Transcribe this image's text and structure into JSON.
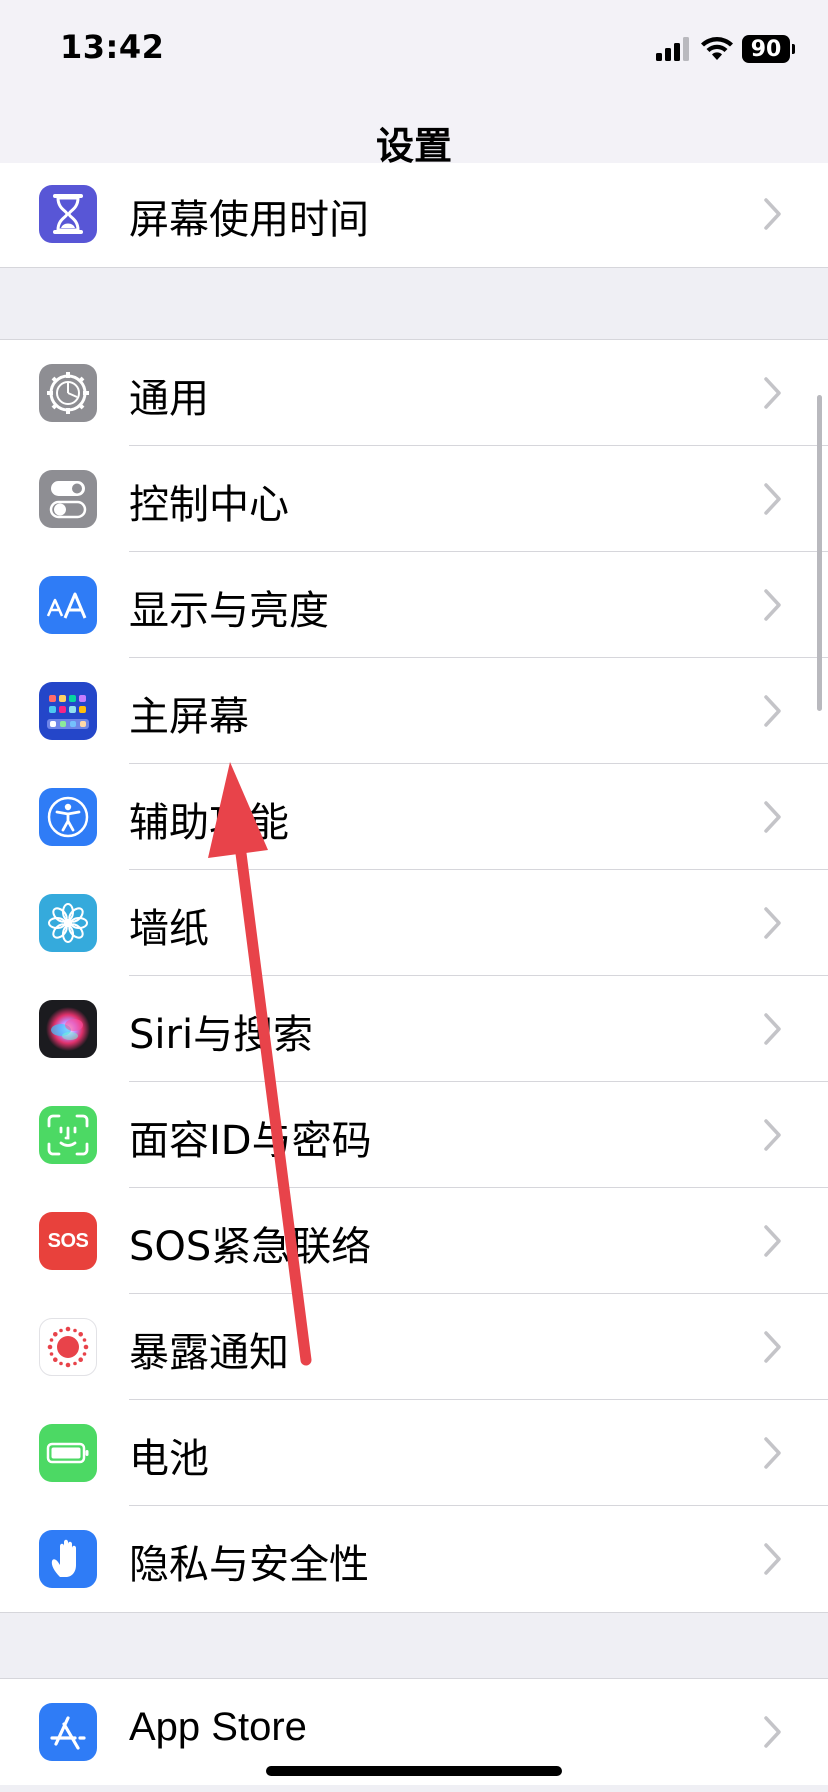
{
  "status": {
    "time": "13:42",
    "battery": "90",
    "signal_icon": "cellular-signal-icon",
    "wifi_icon": "wifi-icon"
  },
  "nav": {
    "title": "设置"
  },
  "groups": [
    [
      {
        "label": "屏幕使用时间",
        "icon": "hourglass-icon",
        "color": "#5856d6"
      }
    ],
    [
      {
        "label": "通用",
        "icon": "gear-icon",
        "color": "#8e8e93"
      },
      {
        "label": "控制中心",
        "icon": "toggle-icon",
        "color": "#8e8e93"
      },
      {
        "label": "显示与亮度",
        "icon": "text-size-icon",
        "color": "#2f7cf6"
      },
      {
        "label": "主屏幕",
        "icon": "home-screen-icon",
        "color": "#2446c9"
      },
      {
        "label": "辅助功能",
        "icon": "accessibility-icon",
        "color": "#2f7cf6"
      },
      {
        "label": "墙纸",
        "icon": "flower-icon",
        "color": "#35aadc"
      },
      {
        "label": "Siri与搜索",
        "icon": "siri-icon",
        "color": "#1b1b1f"
      },
      {
        "label": "面容ID与密码",
        "icon": "face-id-icon",
        "color": "#4cd964"
      },
      {
        "label": "SOS紧急联络",
        "icon": "sos-icon",
        "color": "#e8413c",
        "icon_text": "SOS"
      },
      {
        "label": "暴露通知",
        "icon": "exposure-notification-icon",
        "color": "#ffffff"
      },
      {
        "label": "电池",
        "icon": "battery-icon",
        "color": "#4cd964"
      },
      {
        "label": "隐私与安全性",
        "icon": "hand-icon",
        "color": "#2f7cf6"
      }
    ],
    [
      {
        "label": "App Store",
        "icon": "app-store-icon",
        "color": "#2f7cf6"
      }
    ]
  ],
  "annotation": {
    "color": "#e8434a",
    "icon": "red-arrow-icon"
  }
}
